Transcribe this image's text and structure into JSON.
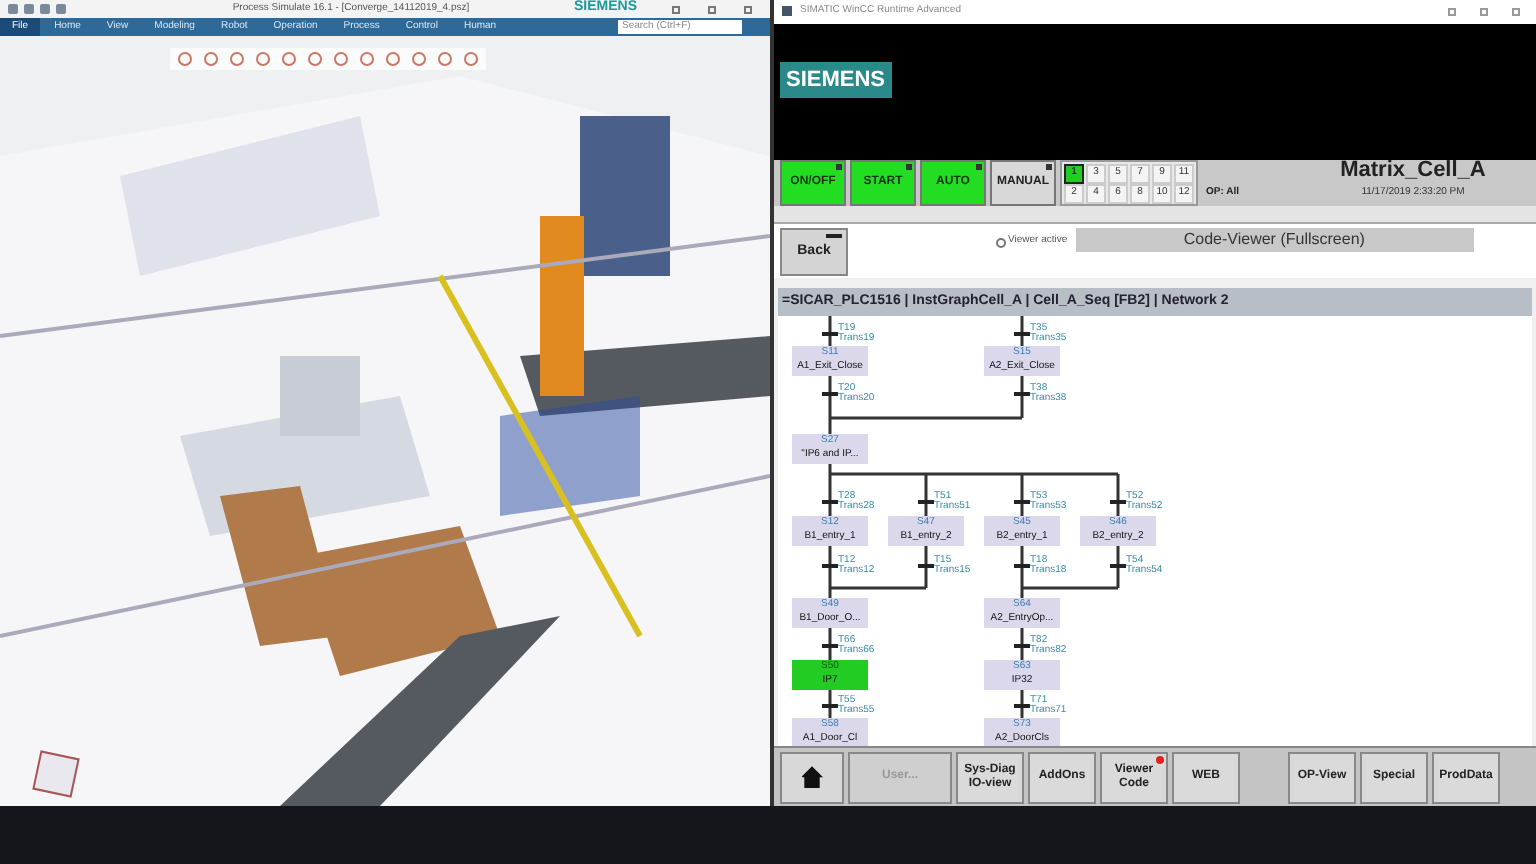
{
  "simulator": {
    "title": "Process Simulate 16.1 - [Converge_14112019_4.psz]",
    "brand": "SIEMENS",
    "menu": [
      {
        "label": "File",
        "selected": true
      },
      {
        "label": "Home",
        "selected": false
      },
      {
        "label": "View",
        "selected": false
      },
      {
        "label": "Modeling",
        "selected": false
      },
      {
        "label": "Robot",
        "selected": false
      },
      {
        "label": "Operation",
        "selected": false
      },
      {
        "label": "Process",
        "selected": false
      },
      {
        "label": "Control",
        "selected": false
      },
      {
        "label": "Human",
        "selected": false
      }
    ],
    "search": {
      "placeholder": "Search (Ctrl+F)"
    }
  },
  "hmi": {
    "window_title": "SIMATIC WinCC Runtime Advanced",
    "logo": "SIEMENS",
    "mode_buttons": [
      {
        "label": "ON/OFF",
        "on": true
      },
      {
        "label": "START",
        "on": true
      },
      {
        "label": "AUTO",
        "on": true
      },
      {
        "label": "MANUAL",
        "on": false
      }
    ],
    "screens": [
      {
        "label": "1",
        "selected": true
      },
      {
        "label": "2",
        "selected": false
      },
      {
        "label": "3",
        "selected": false
      },
      {
        "label": "4",
        "selected": false
      },
      {
        "label": "5",
        "selected": false
      },
      {
        "label": "6",
        "selected": false
      },
      {
        "label": "7",
        "selected": false
      },
      {
        "label": "8",
        "selected": false
      },
      {
        "label": "9",
        "selected": false
      },
      {
        "label": "10",
        "selected": false
      },
      {
        "label": "11",
        "selected": false
      },
      {
        "label": "12",
        "selected": false
      }
    ],
    "operator": "OP: All",
    "cell_name": "Matrix_Cell_A",
    "datetime": "11/17/2019 2:33:20 PM",
    "back_button": "Back",
    "viewer_active": {
      "label": "Viewer active",
      "checked": false
    },
    "viewer_title": "Code-Viewer (Fullscreen)",
    "path": "=SICAR_PLC1516 | InstGraphCell_A | Cell_A_Seq [FB2] | Network 2",
    "sfc": [
      {
        "kind": "transition",
        "id": "T19",
        "name": "Trans19"
      },
      {
        "kind": "transition",
        "id": "T35",
        "name": "Trans35"
      },
      {
        "kind": "step",
        "id": "S11",
        "name": "A1_Exit_Close",
        "active": false
      },
      {
        "kind": "step",
        "id": "S15",
        "name": "A2_Exit_Close",
        "active": false
      },
      {
        "kind": "transition",
        "id": "T20",
        "name": "Trans20"
      },
      {
        "kind": "transition",
        "id": "T38",
        "name": "Trans38"
      },
      {
        "kind": "step",
        "id": "S27",
        "name": "\"IP6 and IP...",
        "active": false
      },
      {
        "kind": "transition",
        "id": "T28",
        "name": "Trans28"
      },
      {
        "kind": "transition",
        "id": "T51",
        "name": "Trans51"
      },
      {
        "kind": "transition",
        "id": "T53",
        "name": "Trans53"
      },
      {
        "kind": "transition",
        "id": "T52",
        "name": "Trans52"
      },
      {
        "kind": "step",
        "id": "S12",
        "name": "B1_entry_1",
        "active": false
      },
      {
        "kind": "step",
        "id": "S47",
        "name": "B1_entry_2",
        "active": false
      },
      {
        "kind": "step",
        "id": "S45",
        "name": "B2_entry_1",
        "active": false
      },
      {
        "kind": "step",
        "id": "S46",
        "name": "B2_entry_2",
        "active": false
      },
      {
        "kind": "transition",
        "id": "T12",
        "name": "Trans12"
      },
      {
        "kind": "transition",
        "id": "T15",
        "name": "Trans15"
      },
      {
        "kind": "transition",
        "id": "T18",
        "name": "Trans18"
      },
      {
        "kind": "transition",
        "id": "T54",
        "name": "Trans54"
      },
      {
        "kind": "step",
        "id": "S49",
        "name": "B1_Door_O...",
        "active": false
      },
      {
        "kind": "step",
        "id": "S64",
        "name": "A2_EntryOp...",
        "active": false
      },
      {
        "kind": "transition",
        "id": "T66",
        "name": "Trans66"
      },
      {
        "kind": "transition",
        "id": "T82",
        "name": "Trans82"
      },
      {
        "kind": "step",
        "id": "S50",
        "name": "IP7",
        "active": true
      },
      {
        "kind": "step",
        "id": "S63",
        "name": "IP32",
        "active": false
      },
      {
        "kind": "transition",
        "id": "T55",
        "name": "Trans55"
      },
      {
        "kind": "transition",
        "id": "T71",
        "name": "Trans71"
      },
      {
        "kind": "step",
        "id": "S58",
        "name": "A1_Door_Cl",
        "active": false
      },
      {
        "kind": "step",
        "id": "S73",
        "name": "A2_DoorCls",
        "active": false
      }
    ],
    "nav_left": [
      {
        "kind": "home"
      },
      {
        "kind": "text",
        "label": "User...",
        "disabled": true
      },
      {
        "kind": "text",
        "label": "Sys-Diag IO-view",
        "disabled": false
      },
      {
        "kind": "text",
        "label": "AddOns",
        "disabled": false
      },
      {
        "kind": "text",
        "label": "Viewer Code",
        "disabled": false,
        "alert": true
      },
      {
        "kind": "text",
        "label": "WEB",
        "disabled": false
      }
    ],
    "nav_right": [
      {
        "kind": "text",
        "label": "OP-View",
        "disabled": false
      },
      {
        "kind": "text",
        "label": "Special",
        "disabled": false
      },
      {
        "kind": "text",
        "label": "ProdData",
        "disabled": false
      }
    ]
  }
}
